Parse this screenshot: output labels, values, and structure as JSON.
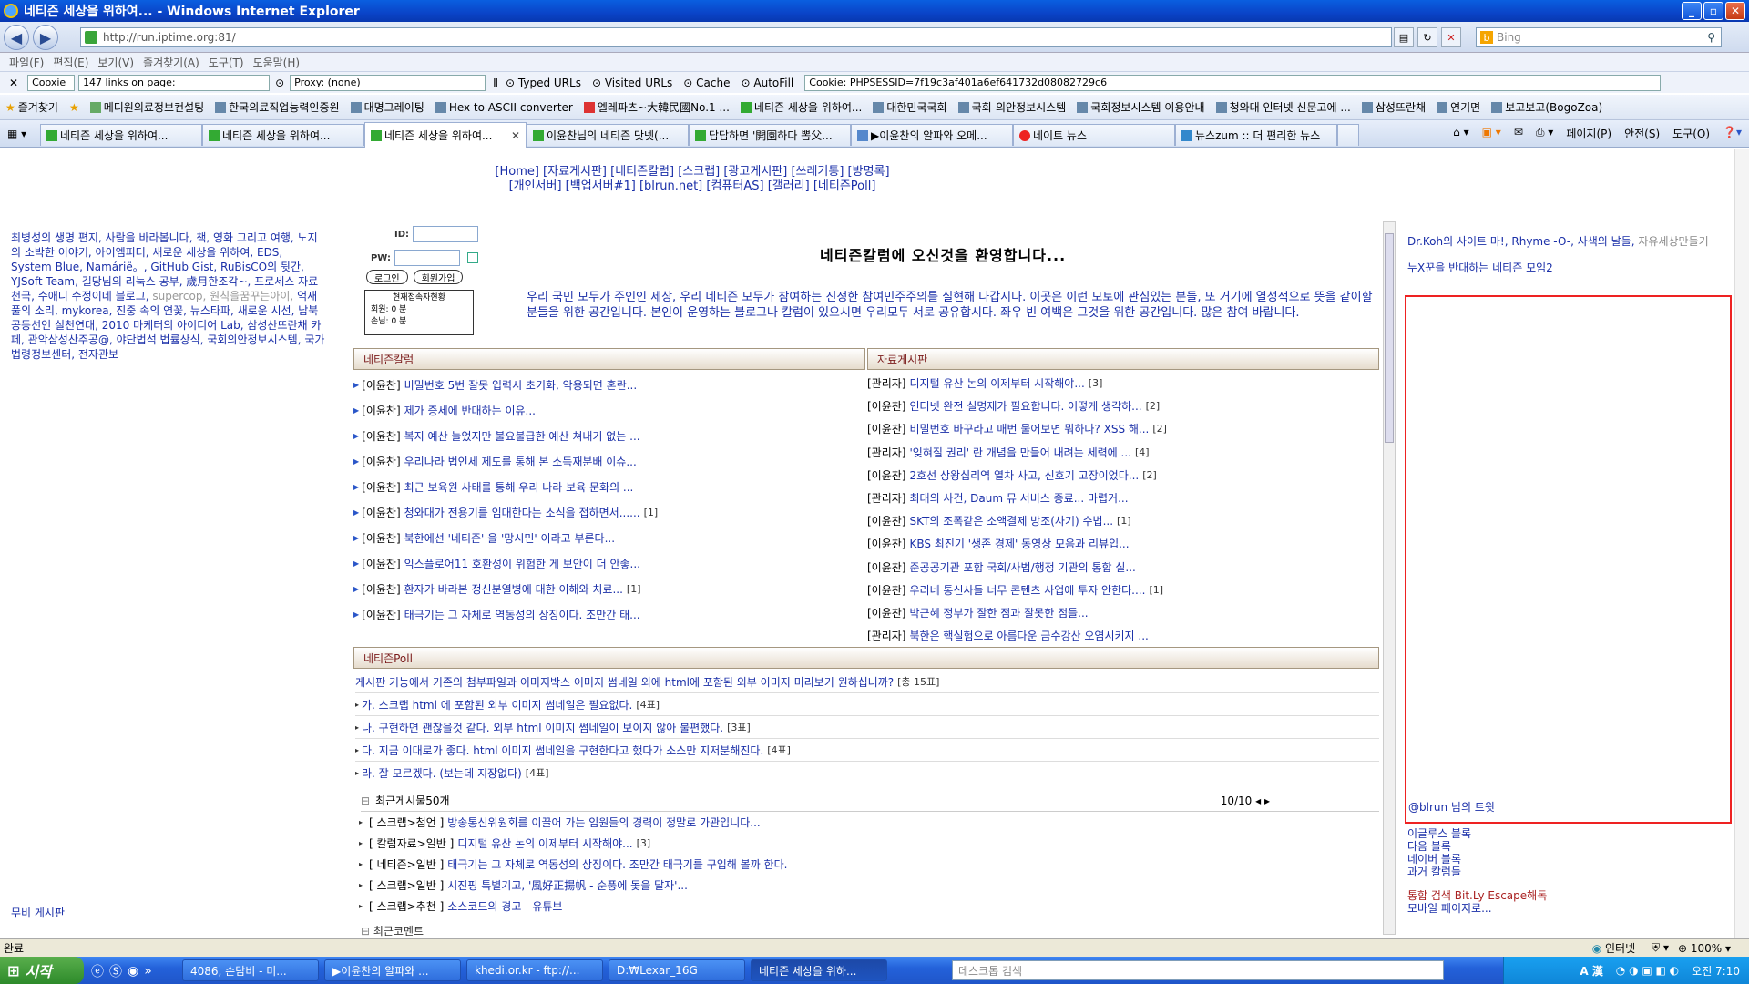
{
  "window": {
    "title": "네티즌 세상을 위하여... - Windows Internet Explorer",
    "minimize": "_",
    "maximize": "▫",
    "close": "✕"
  },
  "address": {
    "url": "http://run.iptime.org:81/",
    "search_placeholder": "Bing"
  },
  "menu": [
    "파일(F)",
    "편집(E)",
    "보기(V)",
    "즐겨찾기(A)",
    "도구(T)",
    "도움말(H)"
  ],
  "toolbar2": {
    "close": "✕",
    "cookie_label": "Cooxie",
    "links_on_page": "147 links on page:",
    "proxy": "Proxy: (none)",
    "typed_urls": "Typed URLs",
    "visited_urls": "Visited URLs",
    "cache": "Cache",
    "autofill": "AutoFill",
    "cookie_value": "Cookie: PHPSESSID=7f19c3af401a6ef641732d08082729c6"
  },
  "favbar": {
    "favorites": "즐겨찾기",
    "items": [
      "메디원의료정보컨설팅",
      "한국의료직업능력인증원",
      "대명그레이팅",
      "Hex to ASCII converter",
      "엘레파츠~大韓民國No.1 ...",
      "네티즌 세상을 위하여...",
      "대한민국국회",
      "국회-의안정보시스템",
      "국회정보시스템 이용안내",
      "청와대 인터넷 신문고에 ...",
      "삼성뜨란채",
      "연기면",
      "보고보고(BogoZoa)"
    ]
  },
  "tabs": [
    {
      "label": "네티즌 세상을 위하여..."
    },
    {
      "label": "네티즌 세상을 위하여..."
    },
    {
      "label": "네티즌 세상을 위하여..."
    },
    {
      "label": "이윤찬님의 네티즌 닷넷(..."
    },
    {
      "label": "답답하면 '開園하다 뽑父..."
    },
    {
      "label": "▶이윤찬의 알파와 오메..."
    },
    {
      "label": "네이트 뉴스"
    },
    {
      "label": "뉴스zum :: 더 편리한 뉴스"
    }
  ],
  "tab_close": "✕",
  "tab_tools": [
    "페이지(P)",
    "안전(S)",
    "도구(O)"
  ],
  "site": {
    "nav_line1": "[Home] [자료게시판] [네티즌칼럼] [스크랩] [광고게시판] [쓰레기통] [방명록]",
    "nav_line2": "[개인서버] [백업서버#1] [blrun.net] [컴퓨터AS] [갤러리] [네티즌Poll]",
    "left_text": "최병성의 생명 편지, 사람을 바라봅니다, 책, 영화 그리고 여행, 노지의 소박한 이야기, 아이엠피터, 새로운 세상을 위하여, EDS, System Blue, Namárië。, GitHub Gist, RuBisCO의 뒷간, YJSoft Team, 길당님의 리눅스 공부, 歲月한조각~, 프로세스 자료천국, 수애니 수정이네 블로그,",
    "left_gray": "supercop, 원칙을꿈꾸는아이,",
    "left_text2": "억새풀의 소리, mykorea, 진중 속의 연꽃, 뉴스타파, 새로운 시선, 남북공동선언 실천연대, 2010 마케터의 아이디어 Lab, 삼성산뜨란채 카페, 관악삼성산주공@, 야단법석 법률상식, 국회의안정보시스템, 국가법령정보센터, 전자관보",
    "left_bottom": "무비 게시판",
    "login": {
      "id_label": "ID:",
      "pw_label": "PW:",
      "login_btn": "로그인",
      "join_btn": "회원가입",
      "stat_title": "현재접속자현황",
      "member_label": "회원:",
      "member_val": "0 분",
      "guest_label": "손님:",
      "guest_val": "0 분"
    },
    "welcome": "네티즌칼럼에 오신것을 환영합니다...",
    "intro": "우리 국민 모두가 주인인 세상, 우리 네티즌 모두가 참여하는 진정한 참여민주주의를 실현해 나갑시다. 이곳은 이런 모토에 관심있는 분들, 또 거기에 열성적으로 뜻을 같이할 분들을 위한 공간입니다. 본인이 운영하는 블로그나 칼럼이 있으시면 우리모두 서로 공유합시다. 좌우 빈 여백은 그것을 위한 공간입니다. 많은 참여 바랍니다.",
    "column_head": "네티즌칼럼",
    "column_items": [
      {
        "cat": "[이윤찬]",
        "title": "비밀번호 5번 잘못 입력시 초기화, 악용되면 혼란...",
        "cnt": ""
      },
      {
        "cat": "[이윤찬]",
        "title": "제가 증세에 반대하는 이유...",
        "cnt": ""
      },
      {
        "cat": "[이윤찬]",
        "title": "복지 예산 늘었지만 불요불급한 예산 쳐내기 없는 ...",
        "cnt": ""
      },
      {
        "cat": "[이윤찬]",
        "title": "우리나라 법인세 제도를 통해 본 소득재분배 이슈...",
        "cnt": ""
      },
      {
        "cat": "[이윤찬]",
        "title": "최근 보육원 사태를 통해 우리 나라 보육 문화의 ...",
        "cnt": ""
      },
      {
        "cat": "[이윤찬]",
        "title": "청와대가 전용기를 임대한다는 소식을 접하면서......",
        "cnt": "[1]"
      },
      {
        "cat": "[이윤찬]",
        "title": "북한에선 '네티즌' 을 '망시민' 이라고 부른다...",
        "cnt": ""
      },
      {
        "cat": "[이윤찬]",
        "title": "익스플로어11 호환성이 위험한 게 보안이 더 안좋...",
        "cnt": ""
      },
      {
        "cat": "[이윤찬]",
        "title": "환자가 바라본 정신분열병에 대한 이해와 치료...",
        "cnt": "[1]"
      },
      {
        "cat": "[이윤찬]",
        "title": "태극기는 그 자체로 역동성의 상징이다. 조만간 태...",
        "cnt": ""
      }
    ],
    "board_head": "자료게시판",
    "board_items": [
      {
        "cat": "[관리자]",
        "title": "디지털 유산 논의 이제부터 시작해야...",
        "cnt": "[3]"
      },
      {
        "cat": "[이윤찬]",
        "title": "인터넷 완전 실명제가 필요합니다. 어떻게 생각하...",
        "cnt": "[2]"
      },
      {
        "cat": "[이윤찬]",
        "title": "비밀번호 바꾸라고 매번 물어보면 뭐하나? XSS 해...",
        "cnt": "[2]"
      },
      {
        "cat": "[관리자]",
        "title": "'잊혀질 권리' 란 개념을 만들어 내려는 세력에 ...",
        "cnt": "[4]"
      },
      {
        "cat": "[이윤찬]",
        "title": "2호선 상왕십리역 열차 사고, 신호기 고장이었다...",
        "cnt": "[2]"
      },
      {
        "cat": "[관리자]",
        "title": "최대의 사건, Daum 뮤 서비스 종료... 마렵거...",
        "cnt": ""
      },
      {
        "cat": "[이윤찬]",
        "title": "SKT의 조폭같은 소액결제 방조(사기) 수법...",
        "cnt": "[1]"
      },
      {
        "cat": "[이윤찬]",
        "title": "KBS 최진기 '생존 경제' 동영상 모음과 리뷰입...",
        "cnt": ""
      },
      {
        "cat": "[이윤찬]",
        "title": "준공공기관 포함 국회/사법/행정 기관의 통합 실...",
        "cnt": ""
      },
      {
        "cat": "[이윤찬]",
        "title": "우리네 통신사들 너무 콘텐츠 사업에 투자 안한다....",
        "cnt": "[1]"
      },
      {
        "cat": "[이윤찬]",
        "title": "박근혜 정부가 잘한 점과 잘못한 점들...",
        "cnt": ""
      },
      {
        "cat": "[관리자]",
        "title": "북한은 핵실험으로 아름다운 금수강산 오염시키지 ...",
        "cnt": ""
      }
    ],
    "poll_head": "네티즌Poll",
    "poll_question": "게시판 기능에서 기존의 첨부파일과 이미지박스 이미지 썸네일 외에 html에 포함된 외부 이미지 미리보기 원하십니까?",
    "poll_total": "[총 15표]",
    "poll_options": [
      {
        "text": "가. 스크랩 html 에 포함된 외부 이미지 썸네일은 필요없다.",
        "cnt": "[4표]"
      },
      {
        "text": "나. 구현하면 괜찮을것 같다. 외부 html 이미지 썸네일이 보이지 않아 불편했다.",
        "cnt": "[3표]"
      },
      {
        "text": "다. 지금 이대로가 좋다. html 이미지 썸네일을 구현한다고 했다가 소스만 지저분해진다.",
        "cnt": "[4표]"
      },
      {
        "text": "라. 잘 모르겠다. (보는데 지장없다)",
        "cnt": "[4표]"
      }
    ],
    "recent_head": "최근게시물50개",
    "recent_page": "10/10",
    "recent_items": [
      {
        "cat": "[ 스크랩>첨언 ]",
        "title": "방송통신위원회를 이끌어 가는 임원들의 경력이 정말로 가관입니다..."
      },
      {
        "cat": "[ 칼럼자료>일반 ]",
        "title": "디지털 유산 논의 이제부터 시작해야...",
        "cnt": "[3]"
      },
      {
        "cat": "[ 네티즌>일반 ]",
        "title": "태극기는 그 자체로 역동성의 상징이다. 조만간 태극기를 구입해 볼까 한다."
      },
      {
        "cat": "[ 스크랩>일반 ]",
        "title": "시진핑 특별기고, '風好正揚帆 - 순풍에 돛을 달자'..."
      },
      {
        "cat": "[ 스크랩>추천 ]",
        "title": "소스코드의 경고 - 유튜브"
      }
    ],
    "recent_comments": "최근코멘트",
    "right_links": "Dr.Koh의 사이트 마!, Rhyme -O-, 사색의 날들,",
    "right_gray": "자유세상만들기",
    "right_group": "누X꾼을 반대하는 네티즌 모임2",
    "tweet_label": "@blrun 님의 트윗",
    "blog_links": [
      "이글루스 블록",
      "다음 블록",
      "네이버 블록",
      "과거 칼럼들"
    ],
    "search_link": "통합 검색 Bit.Ly Escape해독",
    "mobile_link": "모바일 페이지로..."
  },
  "status": {
    "text": "완료",
    "zone": "인터넷",
    "zoom": "100%"
  },
  "taskbar": {
    "start": "시작",
    "tasks": [
      "4086, 손담비 - 미...",
      "▶이윤찬의 알파와 ...",
      "khedi.or.kr - ftp://...",
      "D:₩Lexar_16G",
      "네티즌 세상을 위하..."
    ],
    "search_placeholder": "데스크톱 검색",
    "clock": "오전 7:10",
    "ime": "A 漢"
  }
}
